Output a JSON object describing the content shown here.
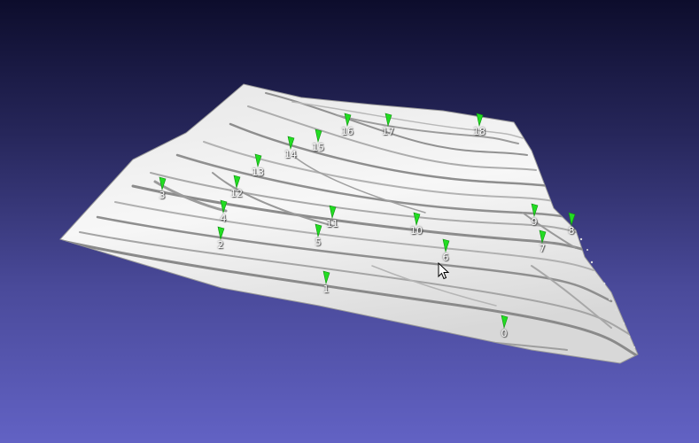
{
  "viewer": {
    "background_top": "#0d0d2c",
    "background_bottom": "#6262c4",
    "mesh_color": "#f2f2f2",
    "marker_color": "#22dd22"
  },
  "markers": [
    {
      "label": "0"
    },
    {
      "label": "1"
    },
    {
      "label": "2"
    },
    {
      "label": "3"
    },
    {
      "label": "4"
    },
    {
      "label": "5"
    },
    {
      "label": "6"
    },
    {
      "label": "7"
    },
    {
      "label": "8"
    },
    {
      "label": "9"
    },
    {
      "label": "10"
    },
    {
      "label": "11"
    },
    {
      "label": "12"
    },
    {
      "label": "13"
    },
    {
      "label": "14"
    },
    {
      "label": "15"
    },
    {
      "label": "16"
    },
    {
      "label": "17"
    },
    {
      "label": "18"
    }
  ]
}
